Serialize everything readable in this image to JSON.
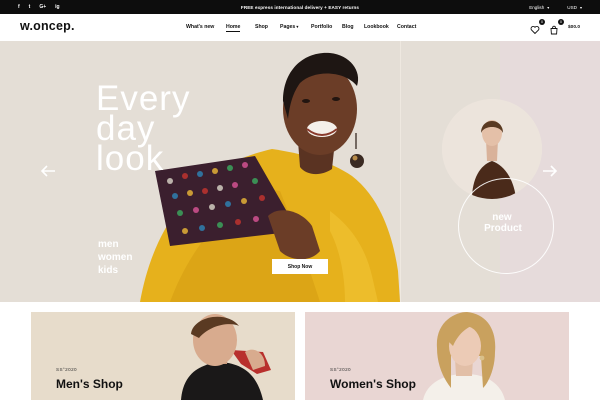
{
  "topbar": {
    "socials": [
      "f",
      "t",
      "G+",
      "ig"
    ],
    "promo": "FREE express international delivery + EASY returns",
    "language": "English",
    "currency": "USD"
  },
  "header": {
    "logo": "w.oncep.",
    "nav": [
      "What's new",
      "Home",
      "Shop",
      "Pages",
      "Portfolio",
      "Blog",
      "Lookbook",
      "Contact"
    ],
    "active_nav": "Home",
    "wishlist_count": "0",
    "cart_count": "0",
    "cart_total": "$00.0"
  },
  "hero": {
    "title": "Every\nday\nlook",
    "categories": [
      "men",
      "women",
      "kids"
    ],
    "cta": "Shop Now",
    "new_product": [
      "new",
      "Product"
    ],
    "colors": {
      "background": "#e4ded6",
      "right_panel": "#e6dbdb",
      "accent_yellow": "#e6b11c"
    }
  },
  "cards": [
    {
      "season": "SS°2020",
      "title": "Men's Shop"
    },
    {
      "season": "SS°2020",
      "title": "Women's Shop"
    }
  ]
}
